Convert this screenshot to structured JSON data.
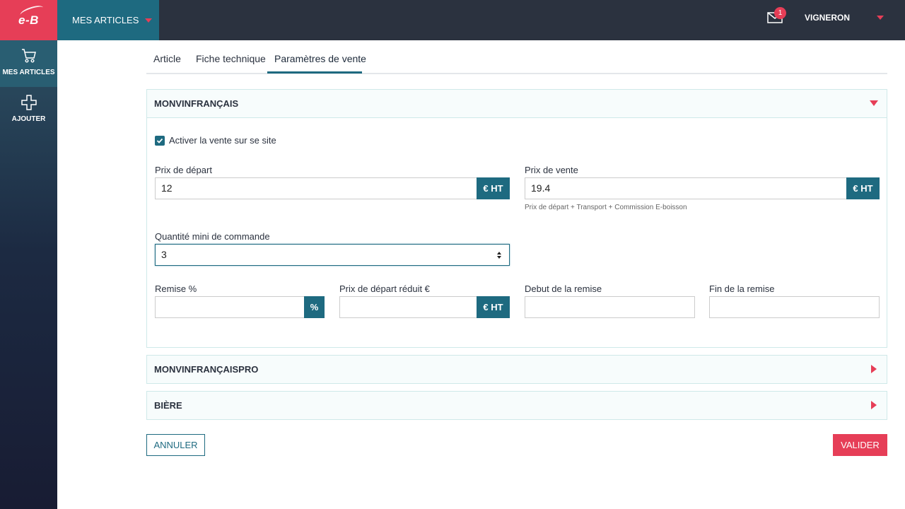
{
  "logo": {
    "text": "e-B"
  },
  "topbar": {
    "menu_label": "MES ARTICLES",
    "notifications_count": "1",
    "user_label": "VIGNERON"
  },
  "sidebar": {
    "items": [
      {
        "label": "MES ARTICLES",
        "icon": "cart-icon"
      },
      {
        "label": "AJOUTER",
        "icon": "plus-icon"
      }
    ]
  },
  "tabs": [
    {
      "label": "Article"
    },
    {
      "label": "Fiche technique"
    },
    {
      "label": "Paramètres de vente"
    }
  ],
  "sections": [
    {
      "title": "MONVINFRANÇAIS",
      "expanded": true,
      "activate_label": "Activer la vente sur se site",
      "activate_checked": true,
      "prix_depart": {
        "label": "Prix de départ",
        "value": "12",
        "addon": "€ HT"
      },
      "prix_vente": {
        "label": "Prix de vente",
        "value": "19.4",
        "addon": "€ HT",
        "hint": "Prix de départ + Transport + Commission E-boisson"
      },
      "quantite": {
        "label": "Quantité mini de commande",
        "value": "3"
      },
      "remise": {
        "label": "Remise %",
        "value": "",
        "addon": "%"
      },
      "prix_reduit": {
        "label": "Prix de départ réduit €",
        "value": "",
        "addon": "€ HT"
      },
      "debut": {
        "label": "Debut de la remise",
        "value": ""
      },
      "fin": {
        "label": "Fin de la remise",
        "value": ""
      }
    },
    {
      "title": "MONVINFRANÇAISPRO",
      "expanded": false
    },
    {
      "title": "BIÈRE",
      "expanded": false
    }
  ],
  "actions": {
    "cancel_label": "ANNULER",
    "submit_label": "VALIDER"
  },
  "colors": {
    "accent": "#e63e57",
    "primary": "#1e6a80",
    "topbar": "#2b323f"
  }
}
